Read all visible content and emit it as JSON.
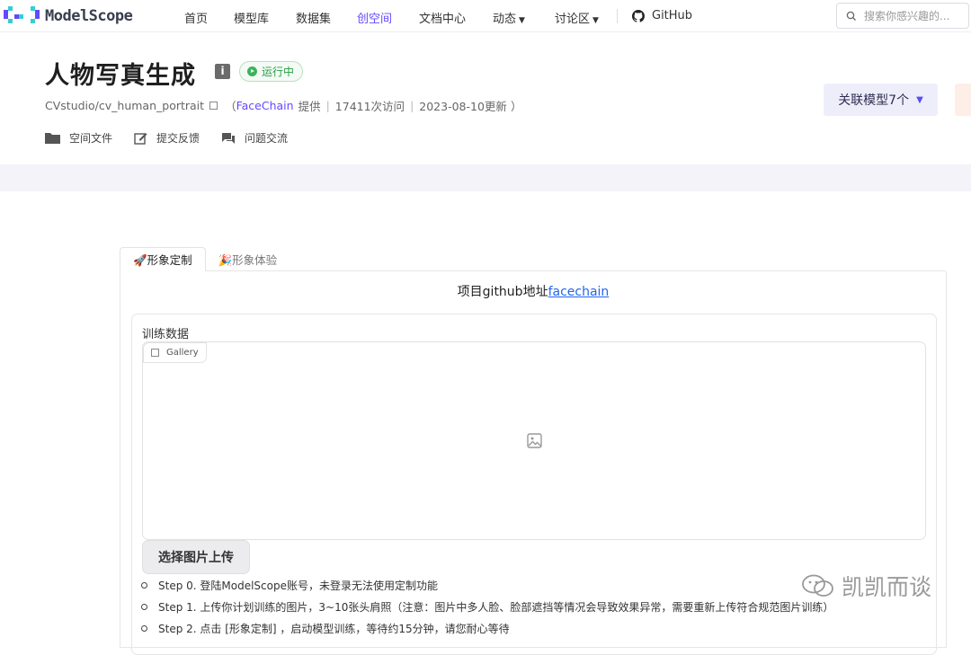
{
  "nav": {
    "logo_text": "ModelScope",
    "items": [
      {
        "label": "首页"
      },
      {
        "label": "模型库"
      },
      {
        "label": "数据集"
      },
      {
        "label": "创空间"
      },
      {
        "label": "文档中心"
      },
      {
        "label": "动态"
      },
      {
        "label": "讨论区"
      },
      {
        "label": "GitHub"
      }
    ],
    "search_placeholder": "搜索你感兴趣的..."
  },
  "header": {
    "title": "人物写真生成",
    "info_glyph": "i",
    "status": "运行中",
    "repo": "CVstudio/cv_human_portrait",
    "provider_open": "（",
    "provider": "FaceChain",
    "provider_suffix": "提供",
    "visits": "17411次访问",
    "updated": "2023-08-10更新",
    "close_paren": "）",
    "actions": [
      {
        "label": "空间文件",
        "icon": "folder-icon"
      },
      {
        "label": "提交反馈",
        "icon": "edit-icon"
      },
      {
        "label": "问题交流",
        "icon": "chat-icon"
      }
    ],
    "related_models": "关联模型7个"
  },
  "tabs": [
    {
      "label": "🚀形象定制",
      "active": true
    },
    {
      "label": "🎉形象体验",
      "active": false
    }
  ],
  "panel": {
    "project_prefix": "项目github地址",
    "project_link": "facechain",
    "training_label": "训练数据",
    "gallery_label": "Gallery",
    "upload_button": "选择图片上传",
    "steps": [
      "Step 0. 登陆ModelScope账号，未登录无法使用定制功能",
      "Step 1. 上传你计划训练的图片，3~10张头肩照（注意：图片中多人脸、脸部遮挡等情况会导致效果异常，需要重新上传符合规范图片训练）",
      "Step 2. 点击 [形象定制] ，启动模型训练，等待约15分钟，请您耐心等待"
    ]
  },
  "watermark": "凯凯而谈",
  "colors": {
    "accent": "#624aff",
    "status_green": "#2a9d46",
    "link_blue": "#2266ee"
  }
}
